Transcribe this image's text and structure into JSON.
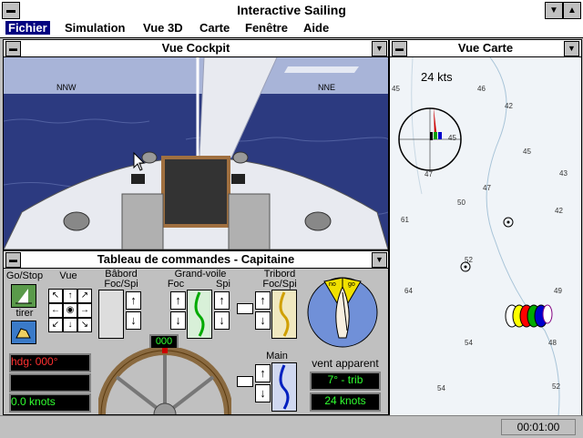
{
  "app": {
    "title": "Interactive Sailing"
  },
  "menu": [
    "Fichier",
    "Simulation",
    "Vue 3D",
    "Carte",
    "Fenêtre",
    "Aide"
  ],
  "cockpit": {
    "title": "Vue Cockpit",
    "heading_left": "NNW",
    "heading_right": "NNE"
  },
  "carte": {
    "title": "Vue Carte",
    "wind_speed": "24 kts",
    "depths": [
      "45",
      "46",
      "45",
      "47",
      "42",
      "45",
      "43",
      "47",
      "50",
      "42",
      "61",
      "52",
      "64",
      "49",
      "54",
      "48",
      "54",
      "52"
    ]
  },
  "panel": {
    "title": "Tableau de commandes  - Capitaine",
    "go_stop": "Go/Stop",
    "tirer": "tirer",
    "vue": "Vue",
    "babord": "Bâbord",
    "babord_sub": "Foc/Spi",
    "grand_voile": "Grand-voile",
    "foc": "Foc",
    "spi": "Spi",
    "tribord": "Tribord",
    "tribord_sub": "Foc/Spi",
    "main": "Main",
    "hdg": "hdg:  000°",
    "speed": "0.0  knots",
    "rudder": "000",
    "vent_apparent": "vent apparent",
    "wind_angle": "7° - trib",
    "wind_knots": "24  knots",
    "gauge_no": "no",
    "gauge_go": "go"
  },
  "status": {
    "clock": "00:01:00"
  },
  "colors": {
    "lcd_red": "#ff3030",
    "lcd_green": "#30ff30",
    "sea": "#2c3a80",
    "sky": "#a8b4d8",
    "chart_bg": "#f0f4f8"
  }
}
